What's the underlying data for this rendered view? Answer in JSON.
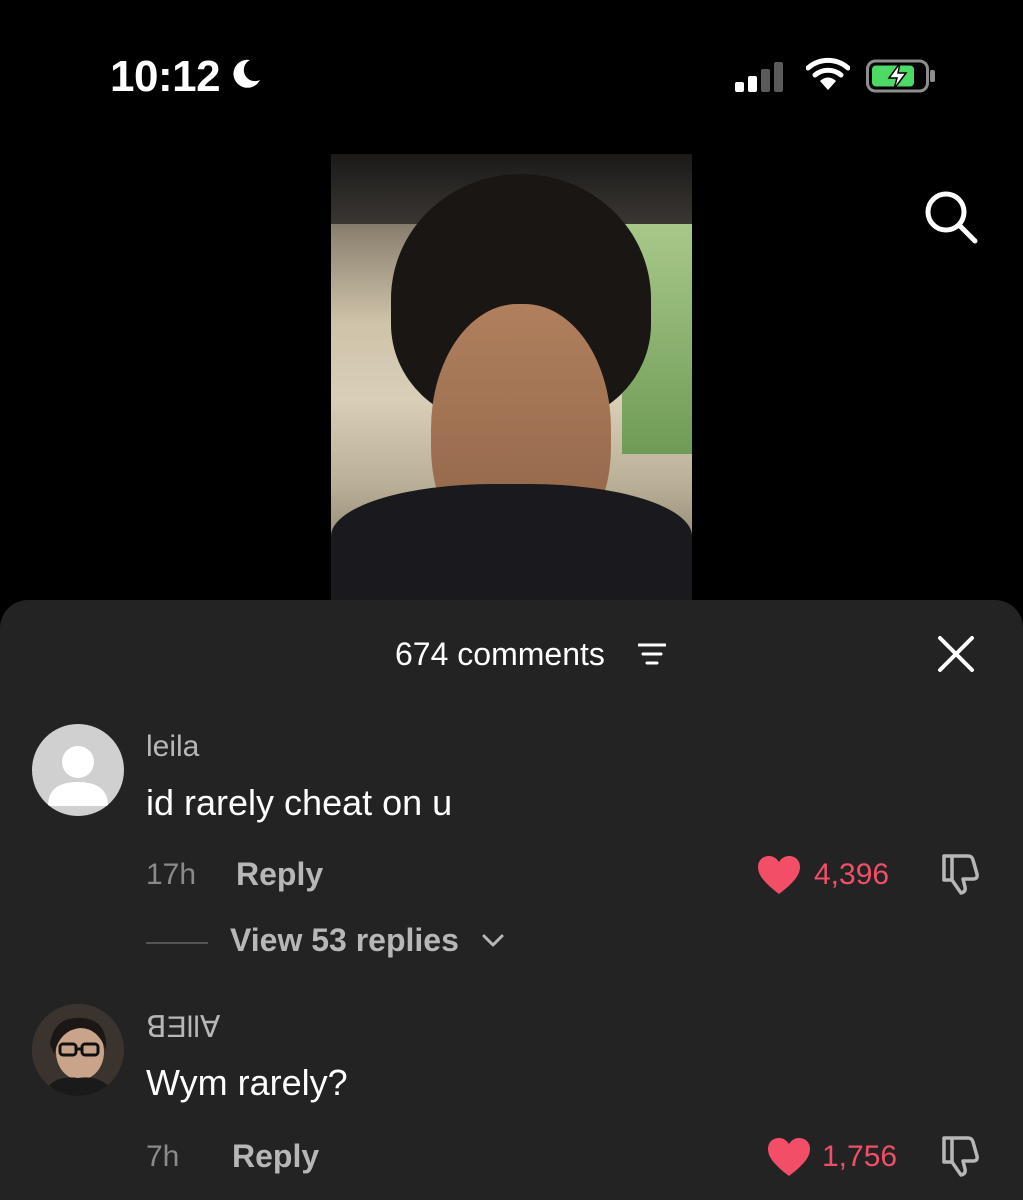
{
  "status_bar": {
    "time": "10:12",
    "icons": [
      "moon-icon",
      "cellular-signal-icon",
      "wifi-icon",
      "battery-charging-icon"
    ]
  },
  "header": {
    "search_icon": "search-icon"
  },
  "comments_sheet": {
    "title": "674 comments",
    "filter_icon": "filter-icon",
    "close_icon": "close-icon",
    "comments": [
      {
        "username": "leila",
        "text": "id rarely cheat on u",
        "time": "17h",
        "reply_label": "Reply",
        "likes": "4,396",
        "view_replies": "View 53 replies"
      },
      {
        "username": "ꓭƎllⱯ",
        "text": "Wym rarely?",
        "time": "7h",
        "reply_label": "Reply",
        "likes": "1,756"
      }
    ]
  },
  "colors": {
    "background": "#000000",
    "sheet": "#232323",
    "like": "#f24e68",
    "muted_text": "#b7b7b7"
  }
}
